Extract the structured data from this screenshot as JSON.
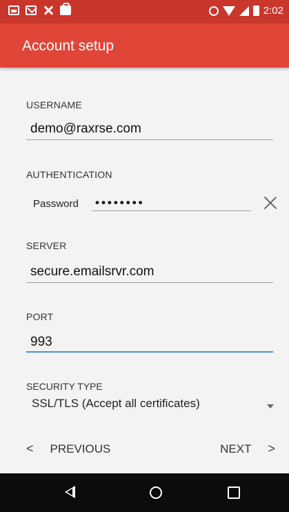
{
  "status_bar": {
    "time": "2:02",
    "left_icons": [
      "picture-icon",
      "mail-icon",
      "tools-icon",
      "bag-icon"
    ],
    "right_icons": [
      "alarm-icon",
      "wifi-icon",
      "signal-icon",
      "battery-icon"
    ]
  },
  "app_bar": {
    "title": "Account setup",
    "color": "#e04638",
    "status_color": "#c9362b"
  },
  "form": {
    "username": {
      "label": "USERNAME",
      "value": "demo@raxrse.com"
    },
    "authentication": {
      "label": "AUTHENTICATION",
      "method": "Password",
      "masked_value": "••••••••",
      "clear_icon": "close-icon"
    },
    "server": {
      "label": "SERVER",
      "value": "secure.emailsrvr.com"
    },
    "port": {
      "label": "PORT",
      "value": "993",
      "active_color": "#4a90e2"
    },
    "security_type": {
      "label": "SECURITY TYPE",
      "value": "SSL/TLS (Accept all certificates)"
    }
  },
  "navigation": {
    "previous_label": "PREVIOUS",
    "next_label": "NEXT",
    "prev_chevron": "<",
    "next_chevron": ">"
  },
  "system_nav": {
    "buttons": [
      "back-icon",
      "home-icon",
      "recents-icon"
    ]
  }
}
